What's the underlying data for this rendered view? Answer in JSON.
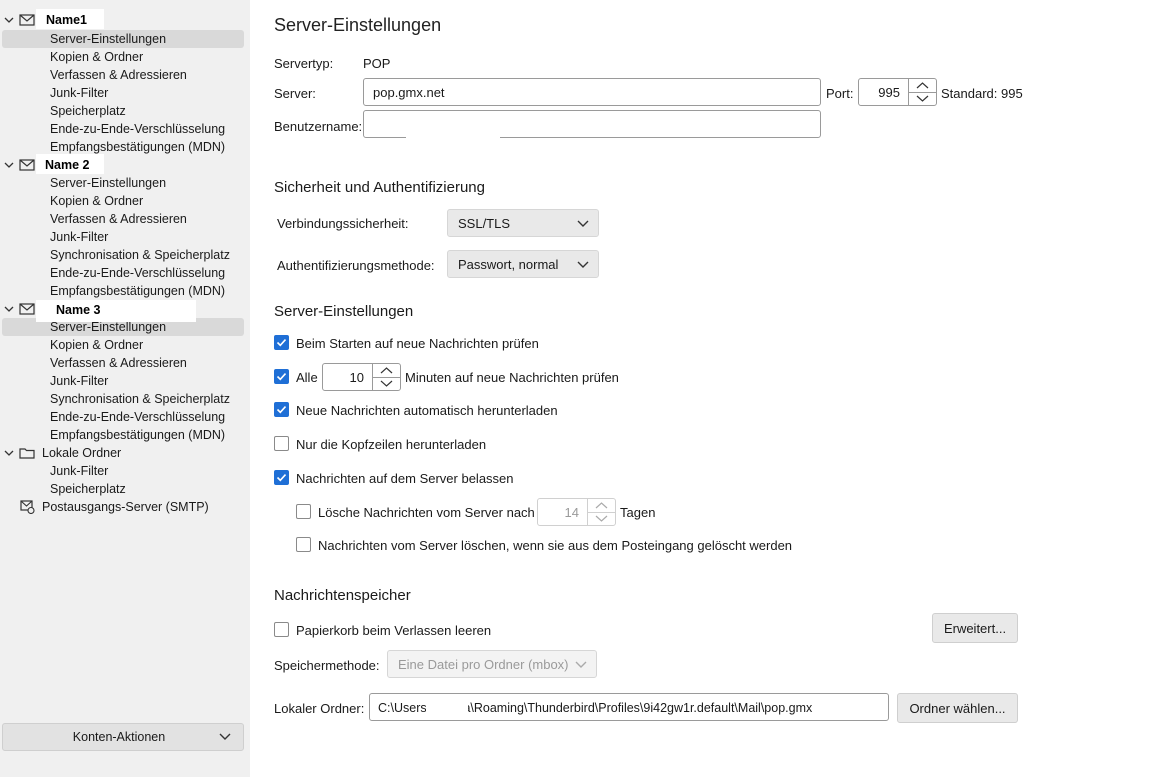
{
  "sidebar": {
    "accounts": [
      {
        "name": "Name1",
        "items": [
          "Server-Einstellungen",
          "Kopien & Ordner",
          "Verfassen & Adressieren",
          "Junk-Filter",
          "Speicherplatz",
          "Ende-zu-Ende-Verschlüsselung",
          "Empfangsbestätigungen (MDN)"
        ]
      },
      {
        "name": "Name 2",
        "items": [
          "Server-Einstellungen",
          "Kopien & Ordner",
          "Verfassen & Adressieren",
          "Junk-Filter",
          "Synchronisation & Speicherplatz",
          "Ende-zu-Ende-Verschlüsselung",
          "Empfangsbestätigungen (MDN)"
        ]
      },
      {
        "name": "Name 3",
        "items": [
          "Server-Einstellungen",
          "Kopien & Ordner",
          "Verfassen & Adressieren",
          "Junk-Filter",
          "Synchronisation & Speicherplatz",
          "Ende-zu-Ende-Verschlüsselung",
          "Empfangsbestätigungen (MDN)"
        ]
      }
    ],
    "local_folders": {
      "name": "Lokale Ordner",
      "items": [
        "Junk-Filter",
        "Speicherplatz"
      ]
    },
    "smtp": "Postausgangs-Server (SMTP)",
    "account_actions": "Konten-Aktionen"
  },
  "main": {
    "title": "Server-Einstellungen",
    "server_type_label": "Servertyp:",
    "server_type_value": "POP",
    "server_label": "Server:",
    "server_value": "pop.gmx.net",
    "port_label": "Port:",
    "port_value": "995",
    "port_default": "Standard: 995",
    "username_label": "Benutzername:",
    "username_value": "",
    "security_heading": "Sicherheit und Authentifizierung",
    "conn_security_label": "Verbindungssicherheit:",
    "conn_security_value": "SSL/TLS",
    "auth_method_label": "Authentifizierungsmethode:",
    "auth_method_value": "Passwort, normal",
    "server_settings_heading": "Server-Einstellungen",
    "check_on_start": {
      "label": "Beim Starten auf neue Nachrichten prüfen",
      "checked": true
    },
    "check_every": {
      "label": "Alle",
      "checked": true,
      "minutes": "10",
      "suffix": "Minuten auf neue Nachrichten prüfen"
    },
    "auto_download": {
      "label": "Neue Nachrichten automatisch herunterladen",
      "checked": true
    },
    "headers_only": {
      "label": "Nur die Kopfzeilen herunterladen",
      "checked": false
    },
    "leave_on_server": {
      "label": "Nachrichten auf dem Server belassen",
      "checked": true
    },
    "delete_after": {
      "label": "Lösche Nachrichten vom Server nach",
      "checked": false,
      "days": "14",
      "suffix": "Tagen"
    },
    "delete_when_deleted": {
      "label": "Nachrichten vom Server löschen, wenn sie aus dem Posteingang gelöscht werden",
      "checked": false
    },
    "storage_heading": "Nachrichtenspeicher",
    "empty_trash": {
      "label": "Papierkorb beim Verlassen leeren",
      "checked": false
    },
    "advanced_button": "Erweitert...",
    "storage_method_label": "Speichermethode:",
    "storage_method_value": "Eine Datei pro Ordner (mbox)",
    "local_folder_label": "Lokaler Ordner:",
    "local_folder_value": "C:\\Users            ppData\\Roaming\\Thunderbird\\Profiles\\9i42gw1r.default\\Mail\\pop.gmx",
    "choose_folder_button": "Ordner wählen..."
  },
  "colors": {
    "accent": "#1f6fd6",
    "sidebar_bg": "#f0f0f0",
    "selected_bg": "#d9d9d9"
  }
}
